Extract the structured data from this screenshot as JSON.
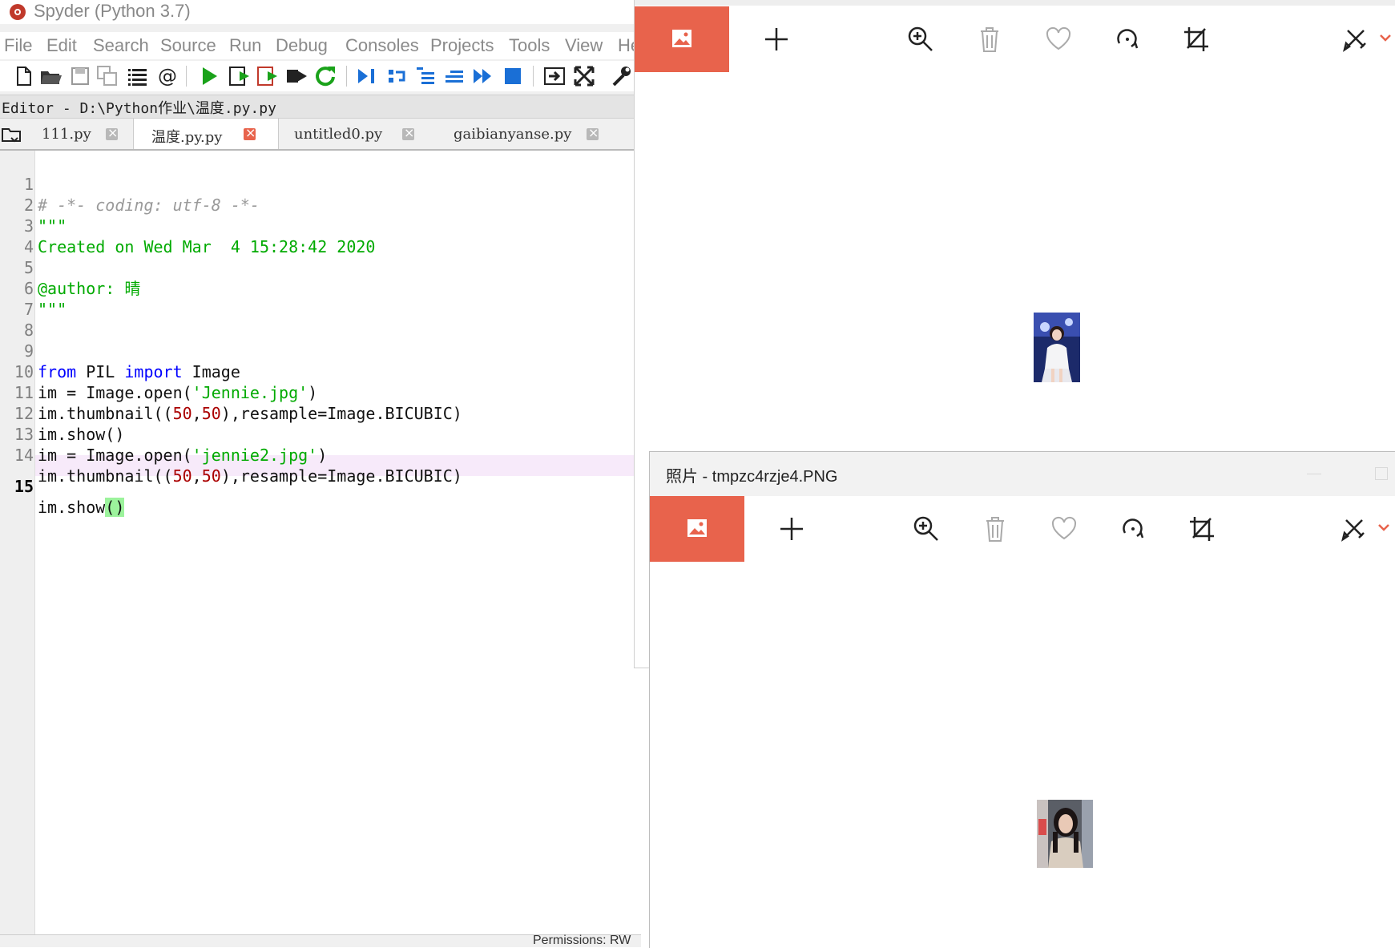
{
  "spyder": {
    "title": "Spyder (Python 3.7)",
    "menu": [
      "File",
      "Edit",
      "Search",
      "Source",
      "Run",
      "Debug",
      "Consoles",
      "Projects",
      "Tools",
      "View",
      "He"
    ],
    "editor_path": "Editor - D:\\Python作业\\温度.py.py",
    "tabs": [
      {
        "label": "111.py",
        "active": false
      },
      {
        "label": "温度.py.py",
        "active": true
      },
      {
        "label": "untitled0.py",
        "active": false
      },
      {
        "label": "gaibianyanse.py",
        "active": false
      }
    ],
    "line_numbers": [
      "1",
      "2",
      "3",
      "4",
      "5",
      "6",
      "7",
      "8",
      "9",
      "10",
      "11",
      "12",
      "13",
      "14",
      "15"
    ],
    "code": {
      "l1": "# -*- coding: utf-8 -*-",
      "l2": "\"\"\"",
      "l3": "Created on Wed Mar  4 15:28:42 2020",
      "l5": "@author: 晴",
      "l6": "\"\"\"",
      "l9_kw1": "from",
      "l9_mid": " PIL ",
      "l9_kw2": "import",
      "l9_end": " Image",
      "l10_a": "im = Image.open(",
      "l10_s": "'Jennie.jpg'",
      "l10_b": ")",
      "l11_a": "im.thumbnail((",
      "l11_n1": "50",
      "l11_c": ",",
      "l11_n2": "50",
      "l11_b": "),resample=Image.BICUBIC)",
      "l12": "im.show()",
      "l13_a": "im = Image.open(",
      "l13_s": "'jennie2.jpg'",
      "l13_b": ")",
      "l14_a": "im.thumbnail((",
      "l14_n1": "50",
      "l14_c": ",",
      "l14_n2": "50",
      "l14_b": "),resample=Image.BICUBIC)",
      "l15_a": "im.show",
      "l15_b": "()"
    },
    "current_line": "15",
    "status_text": "Permissions: RW"
  },
  "photos_window_1": {
    "toolbar_icons": [
      "image-icon",
      "add-icon",
      "zoom-in-icon",
      "delete-icon",
      "favorite-icon",
      "rotate-icon",
      "crop-icon",
      "edit-draw-icon",
      "chevron-down-icon"
    ]
  },
  "photos_window_2": {
    "title": "照片 - tmpzc4rzje4.PNG",
    "toolbar_icons": [
      "image-icon",
      "add-icon",
      "zoom-in-icon",
      "delete-icon",
      "favorite-icon",
      "rotate-icon",
      "crop-icon",
      "edit-draw-icon",
      "chevron-down-icon"
    ]
  },
  "colors": {
    "photos_accent": "#e8634c",
    "code_string": "#00aa00",
    "code_keyword": "#0000ff",
    "code_number": "#aa0000",
    "current_line_bg": "#f7eafa"
  }
}
